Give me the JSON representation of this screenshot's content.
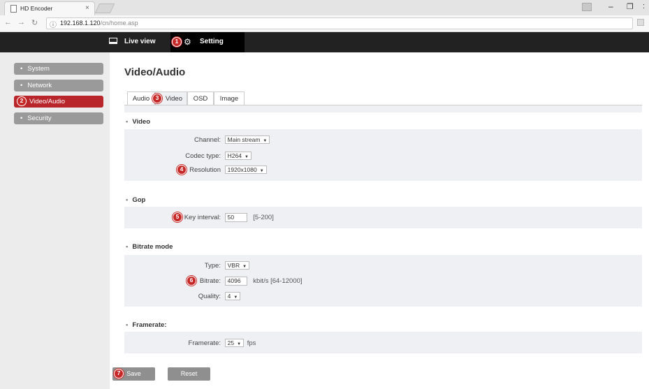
{
  "browser": {
    "tab_title": "HD Encoder",
    "tab_close": "×",
    "url_host": "192.168.1.120",
    "url_path": "/cn/home.asp"
  },
  "header": {
    "live_view": "Live view",
    "setting": "Setting"
  },
  "badges": {
    "b1": "1",
    "b2": "2",
    "b3": "3",
    "b4": "4",
    "b5": "5",
    "b6": "6",
    "b7": "7"
  },
  "sidebar": {
    "items": [
      {
        "label": "System",
        "active": false
      },
      {
        "label": "Network",
        "active": false
      },
      {
        "label": "Video/Audio",
        "active": true
      },
      {
        "label": "Security",
        "active": false
      }
    ]
  },
  "main": {
    "title": "Video/Audio",
    "tabs": [
      {
        "label": "Audio",
        "active": false
      },
      {
        "label": "Video",
        "active": true
      },
      {
        "label": "OSD",
        "active": false
      },
      {
        "label": "Image",
        "active": false
      }
    ]
  },
  "video": {
    "heading": "Video",
    "channel_label": "Channel:",
    "channel_value": "Main stream",
    "codec_label": "Codec type:",
    "codec_value": "H264",
    "resolution_label": "Resolution",
    "resolution_value": "1920x1080"
  },
  "gop": {
    "heading": "Gop",
    "key_interval_label": "Key interval:",
    "key_interval_value": "50",
    "key_interval_range": "[5-200]"
  },
  "bitrate": {
    "heading": "Bitrate mode",
    "type_label": "Type:",
    "type_value": "VBR",
    "bitrate_label": "Bitrate:",
    "bitrate_value": "4096",
    "bitrate_unit": "kbit/s [64-12000]",
    "quality_label": "Quality:",
    "quality_value": "4"
  },
  "framerate": {
    "heading": "Framerate:",
    "label": "Framerate:",
    "value": "25",
    "unit": "fps"
  },
  "actions": {
    "save": "Save",
    "reset": "Reset"
  }
}
